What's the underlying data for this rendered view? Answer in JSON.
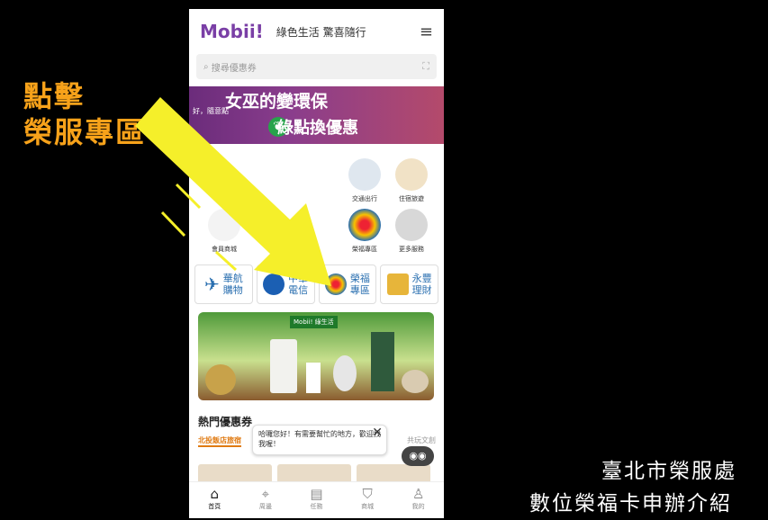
{
  "overlay": {
    "line1": "點擊",
    "line2": "榮服專區"
  },
  "caption": {
    "line1": "臺北市榮服處",
    "line2": "數位榮福卡申辦介紹"
  },
  "app": {
    "logo": "Mobii!",
    "slogan": "綠色生活 驚喜隨行",
    "menu_icon": "≡",
    "search_placeholder": "搜尋優惠券",
    "banner": {
      "title": "女巫的變環保",
      "subtitle": "綠點換優惠",
      "small": "好，隨意點"
    },
    "grid_items": [
      "會員商城",
      "交通出行",
      "住宿旅遊",
      "榮福專區",
      "更多服務"
    ],
    "brands": [
      {
        "line1": "華航",
        "line2": "購物"
      },
      {
        "line1": "中華",
        "line2": "電信"
      },
      {
        "line1": "榮福",
        "line2": "專區"
      },
      {
        "line1": "永豐",
        "line2": "理財"
      }
    ],
    "promo_tag": "Mobii! 綠生活",
    "section_title": "熱門優惠券",
    "subtab_active": "北投飯店旅宿",
    "subtab_other": "共玩文創",
    "chat_text": "哈囉您好！有需要幫忙的地方，歡迎找我喔！",
    "chat_close": "✕",
    "bot_icon": "◉◉",
    "nav": [
      {
        "label": "首頁",
        "icon": "⌂"
      },
      {
        "label": "周邊",
        "icon": "⌖"
      },
      {
        "label": "任務",
        "icon": "▤"
      },
      {
        "label": "商城",
        "icon": "⛉"
      },
      {
        "label": "我的",
        "icon": "♙"
      }
    ]
  }
}
